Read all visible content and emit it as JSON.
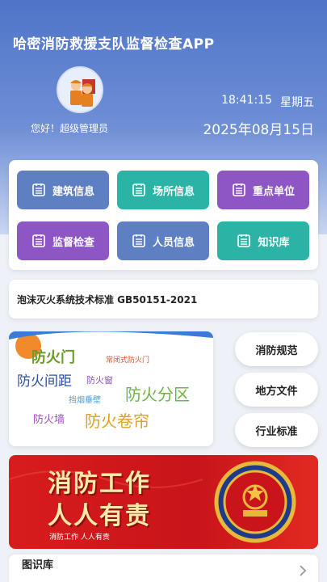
{
  "header": {
    "app_title": "哈密消防救援支队监督检查APP",
    "greeting": "您好！超级管理员",
    "time": "18:41:15",
    "weekday": "星期五",
    "date": "2025年08月15日"
  },
  "menu": [
    {
      "label": "建筑信息",
      "color": "#5e7fc1"
    },
    {
      "label": "场所信息",
      "color": "#2bb3a6"
    },
    {
      "label": "重点单位",
      "color": "#8e56c4"
    },
    {
      "label": "监督检查",
      "color": "#8e56c4"
    },
    {
      "label": "人员信息",
      "color": "#5e7fc1"
    },
    {
      "label": "知识库",
      "color": "#2bb3a6"
    }
  ],
  "notice": {
    "text": "泡沫灭火系统技术标准 GB50151-2021"
  },
  "word_cloud": [
    {
      "text": "防火门",
      "color": "#6c9a2a"
    },
    {
      "text": "常闭式防火门",
      "color": "#d9542b"
    },
    {
      "text": "防火间距",
      "color": "#2b4fa0"
    },
    {
      "text": "防火窗",
      "color": "#8b4fc0"
    },
    {
      "text": "挡烟垂壁",
      "color": "#4a9fd8"
    },
    {
      "text": "防火分区",
      "color": "#6fb24a"
    },
    {
      "text": "防火墙",
      "color": "#a04fc0"
    },
    {
      "text": "防火卷帘",
      "color": "#e0a020"
    }
  ],
  "side_links": [
    "消防规范",
    "地方文件",
    "行业标准"
  ],
  "banner": {
    "line1": "消防工作",
    "line2": "人人有责",
    "footer": "消防工作 人人有责"
  },
  "bottom": {
    "title": "图识库"
  }
}
